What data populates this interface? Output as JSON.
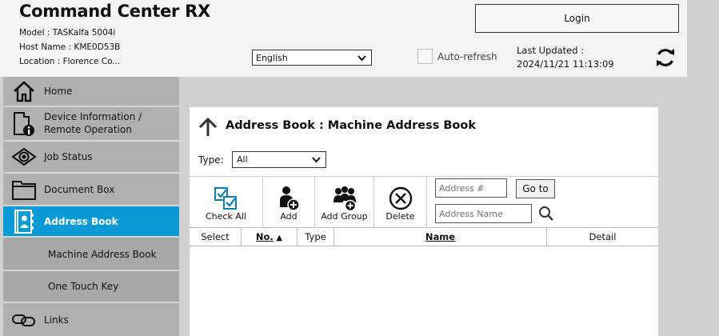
{
  "header": {
    "title": "Command Center RX",
    "model": "Model : TASKalfa 5004i",
    "host_name": "Host Name : KME0D53B",
    "location": "Location : Florence Co...",
    "login_label": "Login",
    "language_selected": "English",
    "auto_refresh_label": "Auto-refresh",
    "last_updated_label": "Last Updated :",
    "last_updated_value": "2024/11/21 11:13:09"
  },
  "sidebar": {
    "items": [
      {
        "label": "Home",
        "icon": "home-icon"
      },
      {
        "label_line1": "Device Information /",
        "label_line2": "Remote Operation",
        "icon": "device-info-icon"
      },
      {
        "label": "Job Status",
        "icon": "eye-icon"
      },
      {
        "label": "Document Box",
        "icon": "folder-icon"
      },
      {
        "label": "Address Book",
        "icon": "address-book-icon",
        "active": true
      },
      {
        "label": "Machine Address Book"
      },
      {
        "label": "One Touch Key"
      },
      {
        "label": "Links",
        "icon": "link-icon"
      }
    ],
    "active_color": "#0a9ad6"
  },
  "main": {
    "title": "Address Book : Machine Address Book",
    "type_label": "Type:",
    "type_selected": "All",
    "toolbar": {
      "check_all": "Check All",
      "add": "Add",
      "add_group": "Add Group",
      "delete": "Delete",
      "address_number_placeholder": "Address #",
      "go_to": "Go to",
      "address_name_placeholder": "Address Name"
    },
    "table": {
      "columns": [
        "Select",
        "No.",
        "Type",
        "Name",
        "Detail"
      ],
      "sort_indicator": "▲"
    }
  }
}
